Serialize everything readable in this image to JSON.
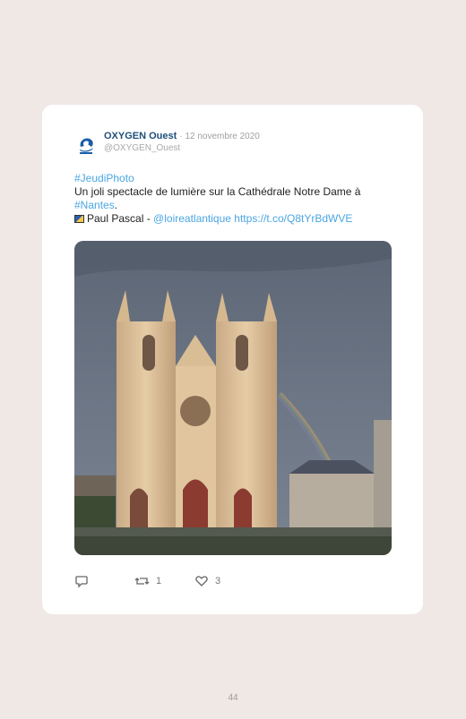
{
  "tweet": {
    "author": "OXYGEN Ouest",
    "date": "· 12 novembre 2020",
    "handle": "@OXYGEN_Ouest",
    "hashtag_1": "#JeudiPhoto",
    "text_1": "Un joli spectacle de lumière sur la Cathédrale Notre Dame à",
    "hashtag_2": "#Nantes",
    "text_2": ".",
    "credit": "Paul Pascal - ",
    "mention": "@loireatlantique",
    "url": "https://t.co/Q8tYrBdWVE",
    "avatar_logo": "oxygen-logo",
    "photo_alt": "Cathédrale Notre Dame de Nantes with rainbow"
  },
  "actions": {
    "replies": "",
    "retweets": "1",
    "likes": "3"
  },
  "page_number": "44",
  "colors": {
    "background": "#efe8e4",
    "card": "#ffffff",
    "link": "#4aa6e3",
    "author": "#1f4f7a"
  }
}
